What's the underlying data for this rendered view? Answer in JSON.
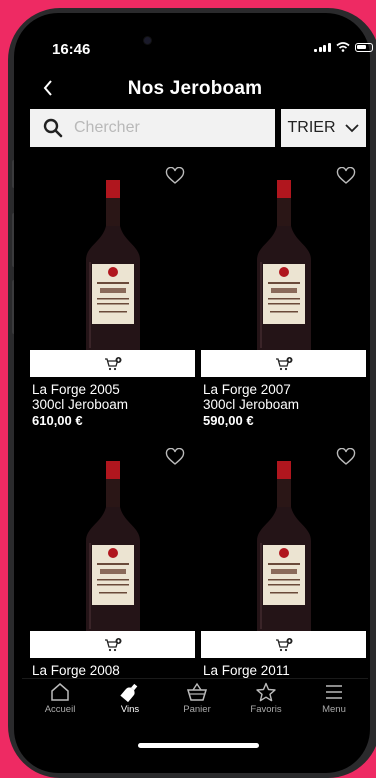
{
  "status_bar": {
    "time": "16:46"
  },
  "header": {
    "title": "Nos Jeroboam",
    "back_icon": "chevron-left-icon"
  },
  "search": {
    "placeholder": "Chercher",
    "value": ""
  },
  "sort": {
    "label": "TRIER"
  },
  "products": [
    {
      "name": "La Forge 2005",
      "size": "300cl Jeroboam",
      "price": "610,00 €"
    },
    {
      "name": "La Forge 2007",
      "size": "300cl Jeroboam",
      "price": "590,00 €"
    },
    {
      "name": "La Forge 2008",
      "size": "",
      "price": ""
    },
    {
      "name": "La Forge 2011",
      "size": "",
      "price": ""
    }
  ],
  "tabbar": {
    "items": [
      {
        "label": "Accueil",
        "icon": "home-icon"
      },
      {
        "label": "Vins",
        "icon": "wine-bottle-icon",
        "active": true
      },
      {
        "label": "Panier",
        "icon": "basket-icon"
      },
      {
        "label": "Favoris",
        "icon": "star-icon"
      },
      {
        "label": "Menu",
        "icon": "menu-icon"
      }
    ]
  },
  "colors": {
    "background": "#ee2a63",
    "screen": "#000000",
    "bottle_cap": "#b0161e"
  }
}
